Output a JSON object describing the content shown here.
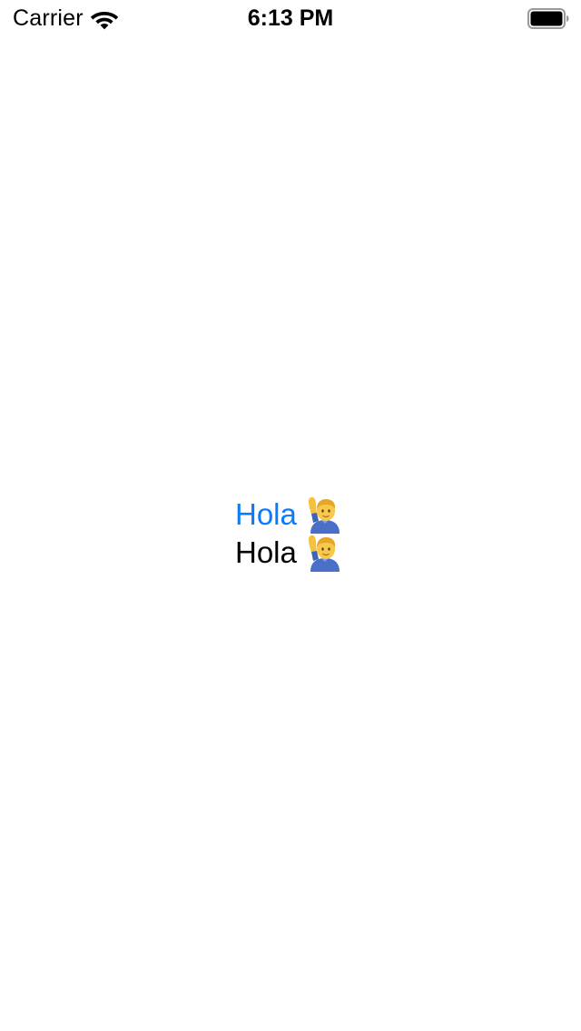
{
  "status_bar": {
    "carrier": "Carrier",
    "time": "6:13 PM",
    "wifi_icon": "wifi-icon",
    "battery_icon": "battery-full-icon"
  },
  "content": {
    "link_greeting": {
      "text": "Hola",
      "emoji": "🙋‍♂️",
      "emoji_icon": "man-raising-hand-icon",
      "color": "#0a7aff"
    },
    "plain_greeting": {
      "text": "Hola",
      "emoji": "🙋‍♂️",
      "emoji_icon": "man-raising-hand-icon",
      "color": "#000000"
    }
  }
}
